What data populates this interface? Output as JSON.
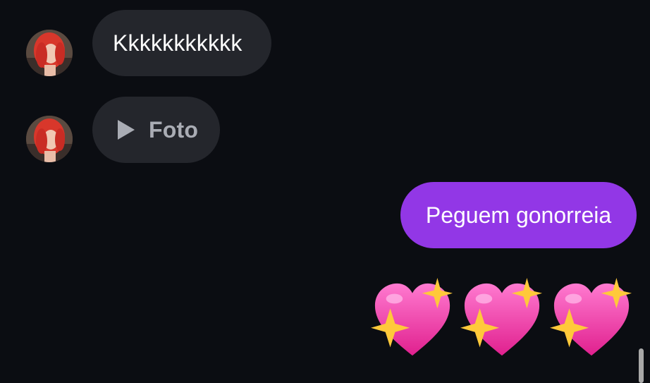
{
  "conversation": {
    "messages": [
      {
        "direction": "incoming",
        "type": "text",
        "text": "Kkkkkkkkkkk"
      },
      {
        "direction": "incoming",
        "type": "attachment",
        "label": "Foto",
        "icon": "play-icon"
      },
      {
        "direction": "outgoing",
        "type": "text",
        "text": "Peguem gonorreia"
      },
      {
        "direction": "outgoing",
        "type": "emoji",
        "emoji": "💖💖💖",
        "icon": "sparkling-heart-icon",
        "count": 3
      }
    ]
  },
  "colors": {
    "background": "#0b0d12",
    "incoming_bubble": "#24262c",
    "outgoing_bubble": "#9237e6",
    "attachment_text": "#a9acb4",
    "heart": "#f23aa5",
    "sparkle": "#ffc93a"
  }
}
